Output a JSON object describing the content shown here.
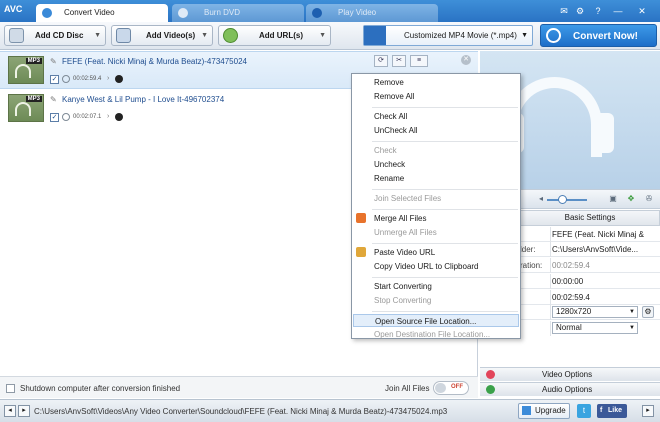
{
  "app": {
    "logo": "AVC",
    "tabs": [
      {
        "label": "Convert Video",
        "active": true
      },
      {
        "label": "Burn DVD",
        "active": false
      },
      {
        "label": "Play Video",
        "active": false
      }
    ],
    "window_controls": [
      "✉",
      "⚙",
      "?",
      "—",
      "✕"
    ]
  },
  "toolbar": {
    "add_cd": "Add CD Disc",
    "add_videos": "Add Video(s)",
    "add_urls": "Add URL(s)",
    "profile": "Customized MP4 Movie (*.mp4)",
    "convert": "Convert Now!"
  },
  "files": [
    {
      "name": "FEFE (Feat. Nicki Minaj & Murda Beatz)-473475024",
      "badge": "MP3",
      "duration": "00:02:59.4",
      "checked": true,
      "selected": true
    },
    {
      "name": "Kanye West & Lil Pump - I Love It-496702374",
      "badge": "MP3",
      "duration": "00:02:07.1",
      "checked": true,
      "selected": false
    }
  ],
  "context_menu": [
    {
      "label": "Remove",
      "enabled": true
    },
    {
      "label": "Remove All",
      "enabled": true
    },
    {
      "sep": true
    },
    {
      "label": "Check All",
      "enabled": true
    },
    {
      "label": "UnCheck All",
      "enabled": true
    },
    {
      "sep": true
    },
    {
      "label": "Check",
      "enabled": false
    },
    {
      "label": "Uncheck",
      "enabled": true
    },
    {
      "label": "Rename",
      "enabled": true
    },
    {
      "sep": true
    },
    {
      "label": "Join Selected Files",
      "enabled": false
    },
    {
      "sep": true
    },
    {
      "label": "Merge All Files",
      "enabled": true,
      "icon": "merge-icon"
    },
    {
      "label": "Unmerge All Files",
      "enabled": false
    },
    {
      "sep": true
    },
    {
      "label": "Paste Video URL",
      "enabled": true,
      "icon": "paste-icon"
    },
    {
      "label": "Copy Video URL to Clipboard",
      "enabled": true
    },
    {
      "sep": true
    },
    {
      "label": "Start Converting",
      "enabled": true
    },
    {
      "label": "Stop Converting",
      "enabled": false
    },
    {
      "sep": true
    },
    {
      "label": "Open Source File Location...",
      "enabled": true,
      "highlighted": true
    },
    {
      "label": "Open Destination File Location...",
      "enabled": false
    }
  ],
  "settings": {
    "header": "Basic Settings",
    "rows": [
      {
        "key": "",
        "value": "FEFE (Feat. Nicki Minaj & Murda",
        "gray": false
      },
      {
        "key": "lder:",
        "value": "C:\\Users\\AnvSoft\\Vide...",
        "gray": false
      },
      {
        "key": "ration:",
        "value": "00:02:59.4",
        "gray": true
      },
      {
        "key": "",
        "value": "00:00:00",
        "gray": false
      },
      {
        "key": "",
        "value": "00:02:59.4",
        "gray": false
      }
    ],
    "resolution": "1280x720",
    "quality": "Normal"
  },
  "options": {
    "video": "Video Options",
    "audio": "Audio Options"
  },
  "bottom": {
    "shutdown": "Shutdown computer after conversion finished",
    "join": "Join All Files",
    "toggle": "OFF"
  },
  "status": {
    "path": "C:\\Users\\AnvSoft\\Videos\\Any Video Converter\\Soundcloud\\FEFE (Feat. Nicki Minaj & Murda Beatz)-473475024.mp3",
    "upgrade": "Upgrade",
    "like": "Like"
  },
  "colors": {
    "accent": "#2a73c4",
    "convert": "#1d6ec8",
    "selected_row": "#d9e9f8"
  }
}
